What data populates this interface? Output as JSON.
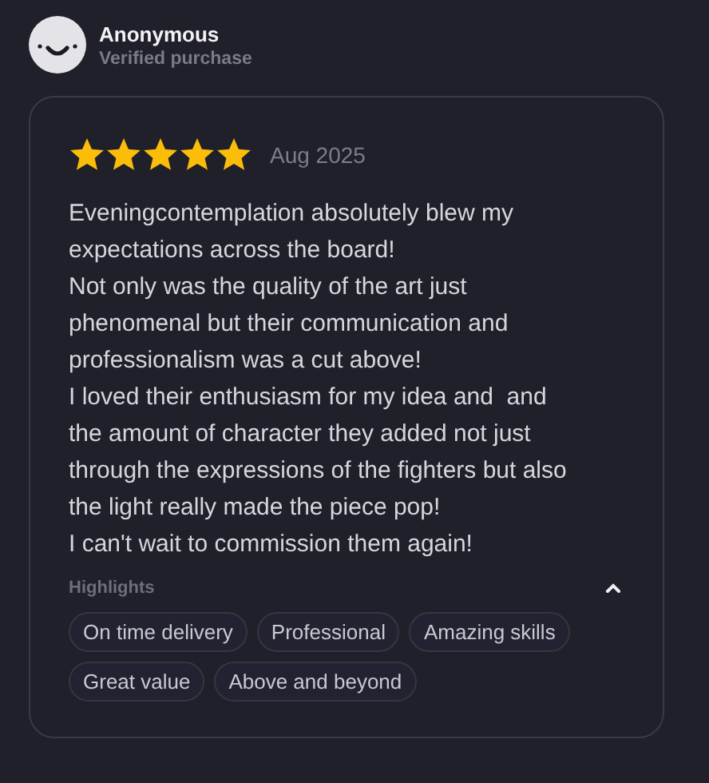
{
  "reviewer": {
    "name": "Anonymous",
    "status": "Verified purchase"
  },
  "review": {
    "stars": 5,
    "date": "Aug 2025",
    "paragraphs": [
      "Eveningcontemplation absolutely blew my expectations across the board!",
      "Not only was the quality of the art just phenomenal but their communication and professionalism was a cut above!",
      "I loved their enthusiasm for my idea and  and the amount of character they added not just through the expressions of the fighters but also the light really made the piece pop!",
      "I can't wait to commission them again!"
    ]
  },
  "highlights": {
    "title": "Highlights",
    "expanded": true,
    "tags": [
      "On time delivery",
      "Professional",
      "Amazing skills",
      "Great value",
      "Above and beyond"
    ]
  }
}
